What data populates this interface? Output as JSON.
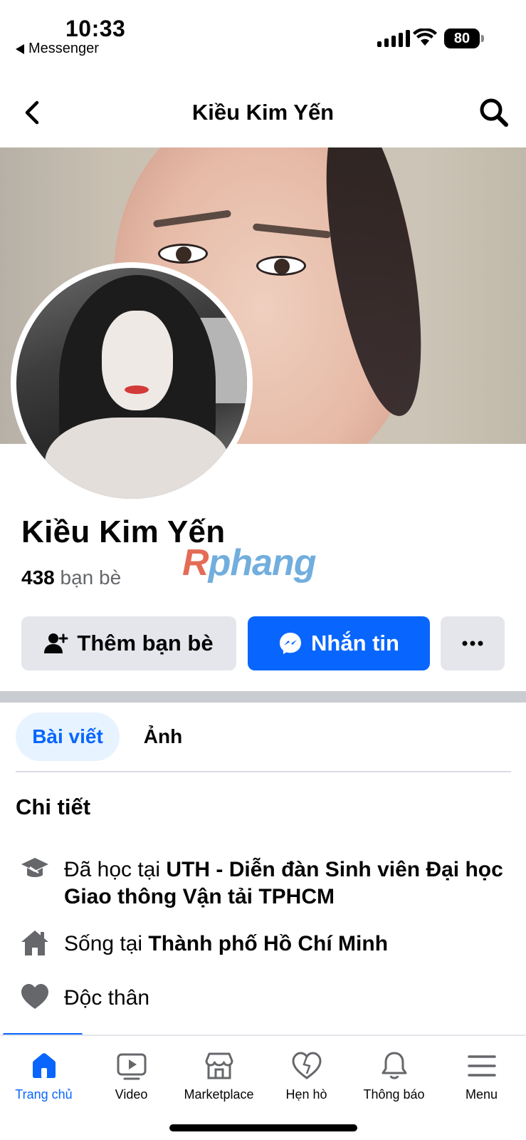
{
  "status_bar": {
    "time": "10:33",
    "back_app": "Messenger",
    "battery": "80"
  },
  "header": {
    "title": "Kiều Kim Yến",
    "back_icon": "chevron-left-icon",
    "search_icon": "search-icon"
  },
  "profile": {
    "name": "Kiều Kim Yến",
    "friends_count": "438",
    "friends_label": "bạn bè",
    "watermark": "Rphang"
  },
  "actions": {
    "add_friend": "Thêm bạn bè",
    "message": "Nhắn tin",
    "more": "···"
  },
  "tabs": [
    {
      "label": "Bài viết",
      "active": true
    },
    {
      "label": "Ảnh",
      "active": false
    }
  ],
  "details": {
    "title": "Chi tiết",
    "education_prefix": "Đã học tại ",
    "education_value": "UTH - Diễn đàn Sinh viên Đại học Giao thông Vận tải TPHCM",
    "lives_prefix": "Sống tại ",
    "lives_value": "Thành phố Hồ Chí Minh",
    "relationship": "Độc thân"
  },
  "nav": [
    {
      "label": "Trang chủ",
      "icon": "home-icon",
      "active": true
    },
    {
      "label": "Video",
      "icon": "video-icon",
      "active": false
    },
    {
      "label": "Marketplace",
      "icon": "marketplace-icon",
      "active": false
    },
    {
      "label": "Hẹn hò",
      "icon": "dating-heart-icon",
      "active": false
    },
    {
      "label": "Thông báo",
      "icon": "bell-icon",
      "active": false
    },
    {
      "label": "Menu",
      "icon": "menu-icon",
      "active": false
    }
  ],
  "colors": {
    "accent": "#0866ff",
    "button_gray": "#e4e6eb",
    "tab_active_bg": "#e7f3ff",
    "secondary_text": "#65676b"
  }
}
